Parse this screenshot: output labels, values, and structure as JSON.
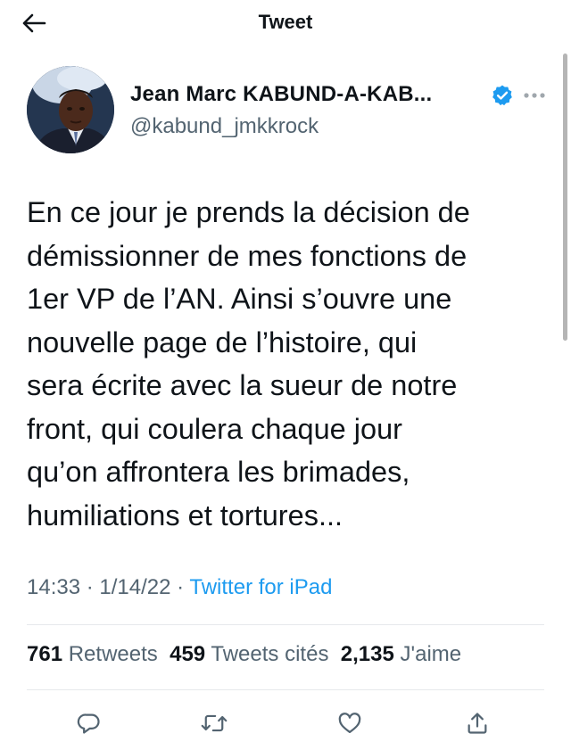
{
  "header": {
    "title": "Tweet",
    "back_icon": "arrow-left-icon"
  },
  "author": {
    "display_name": "Jean Marc KABUND-A-KAB...",
    "handle": "@kabund_jmkkrock",
    "verified": true,
    "verified_color": "#1d9bf0"
  },
  "tweet": {
    "lines": [
      "En ce jour je prends la décision de",
      "démissionner de mes fonctions de",
      "1er VP de l’AN. Ainsi s’ouvre une",
      "nouvelle page de l’histoire, qui",
      "sera écrite avec la sueur de notre",
      "front, qui coulera chaque jour",
      "qu’on affrontera les brimades,",
      "humiliations et tortures..."
    ]
  },
  "meta": {
    "time": "14:33",
    "separator": "·",
    "date": "1/14/22",
    "source": "Twitter for iPad"
  },
  "stats": {
    "retweets_count": "761",
    "retweets_label": "Retweets",
    "quotes_count": "459",
    "quotes_label": "Tweets cités",
    "likes_count": "2,135",
    "likes_label": "J'aime"
  },
  "actions": [
    "reply-icon",
    "retweet-icon",
    "like-icon",
    "share-icon"
  ],
  "colors": {
    "accent": "#1d9bf0",
    "secondary_text": "#536471",
    "primary_text": "#0f1419",
    "icon": "#536471"
  }
}
